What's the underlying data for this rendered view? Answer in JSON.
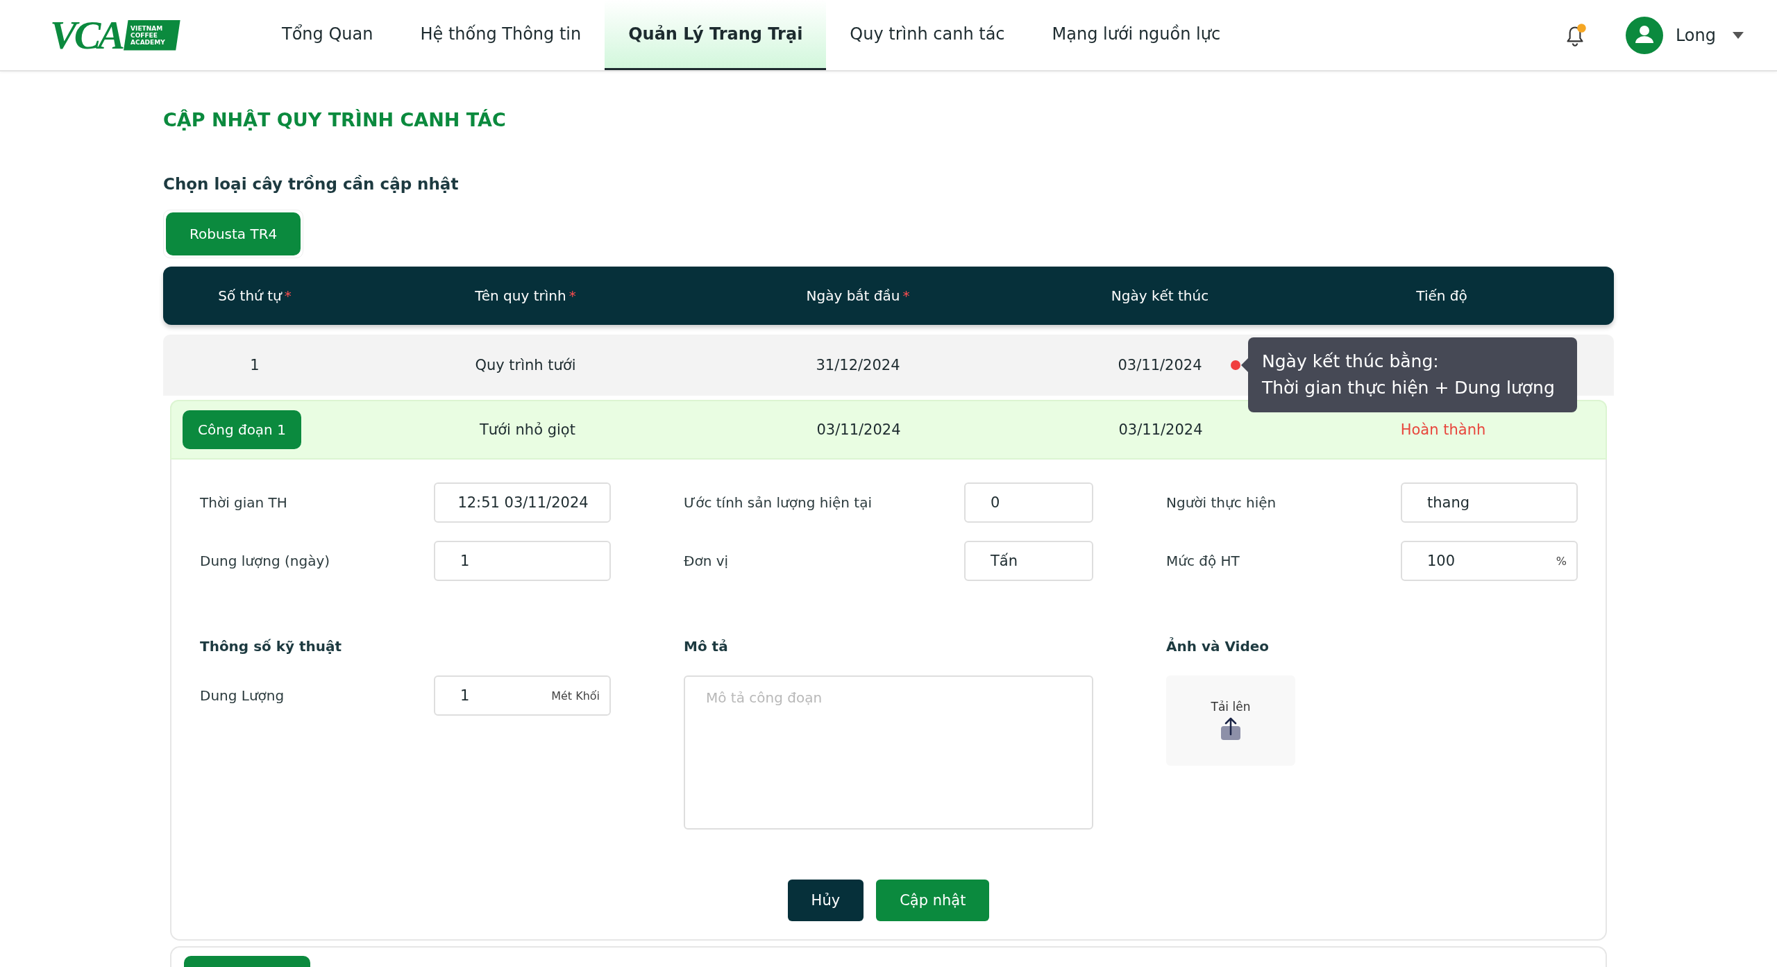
{
  "header": {
    "logo": {
      "mark": "VCA",
      "tagline": [
        "VIETNAM",
        "COFFEE",
        "ACADEMY"
      ]
    },
    "nav": [
      {
        "label": "Tổng Quan",
        "selected": false
      },
      {
        "label": "Hệ thống Thông tin",
        "selected": false
      },
      {
        "label": "Quản Lý Trang Trại",
        "selected": true
      },
      {
        "label": "Quy trình canh tác",
        "selected": false
      },
      {
        "label": "Mạng lưới nguồn lực",
        "selected": false
      }
    ],
    "notification": {
      "unread": true
    },
    "user": {
      "name": "Long"
    }
  },
  "page": {
    "title": "CẬP NHẬT QUY TRÌNH CANH TÁC",
    "crop_prompt": "Chọn loại cây trồng cần cập nhật",
    "crops": [
      {
        "label": "Robusta TR4",
        "selected": true
      }
    ]
  },
  "table": {
    "columns": [
      {
        "label": "Số thứ tự",
        "required_mark": "*"
      },
      {
        "label": "Tên quy trình",
        "required_mark": "*"
      },
      {
        "label": "Ngày bắt đầu",
        "required_mark": "*"
      },
      {
        "label": "Ngày kết thúc"
      },
      {
        "label": "Tiến độ"
      }
    ],
    "rows": [
      {
        "cells": [
          "1",
          "Quy trình tưới",
          "31/12/2024",
          "03/11/2024"
        ],
        "warning": true
      }
    ]
  },
  "tooltip": {
    "lines": [
      "Ngày kết thúc bằng:",
      "Thời gian thực hiện + Dung lượng"
    ]
  },
  "stage": {
    "button": "Công đoạn 1",
    "name": "Tưới nhỏ giọt",
    "start": "03/11/2024",
    "end": "03/11/2024",
    "status": "Hoàn thành"
  },
  "fields": [
    {
      "label": "Thời gian TH",
      "value": "12:51 03/11/2024"
    },
    {
      "label": "Ước tính sản lượng hiện tại",
      "value": "0"
    },
    {
      "label": "Người thực hiện",
      "value": "thang"
    },
    {
      "label": "Dung lượng (ngày)",
      "value": "1"
    },
    {
      "label": "Đơn vị",
      "value": "Tấn"
    },
    {
      "label": "Mức độ HT",
      "value": "100",
      "unit": "%"
    }
  ],
  "specs": {
    "title": "Thông số kỹ thuật",
    "fields": [
      {
        "label": "Dung Lượng",
        "value": "1",
        "unit": "Mét Khối"
      }
    ]
  },
  "description": {
    "title": "Mô tả",
    "placeholder": "Mô tả công đoạn"
  },
  "media": {
    "title": "Ảnh và Video",
    "upload_label": "Tải lên"
  },
  "actions": [
    {
      "label": "Hủy",
      "kind": "cancel"
    },
    {
      "label": "Cập nhật",
      "kind": "primary"
    }
  ]
}
